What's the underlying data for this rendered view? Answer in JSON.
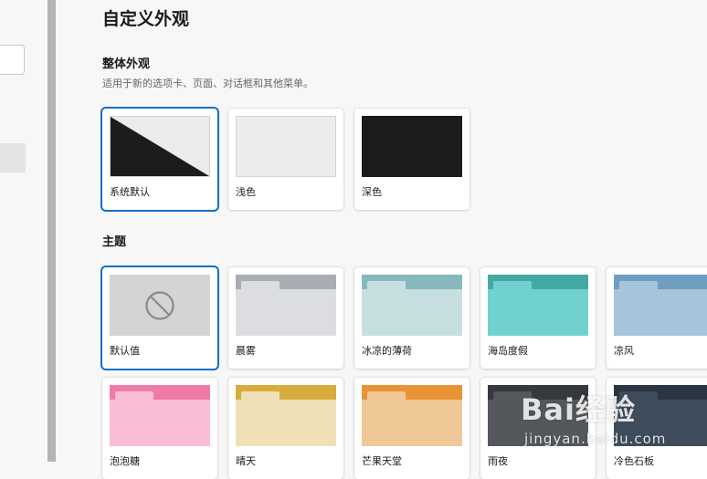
{
  "page": {
    "title": "自定义外观"
  },
  "appearance": {
    "title": "整体外观",
    "description": "适用于新的选项卡、页面、对话框和其他菜单。",
    "options": [
      {
        "label": "系统默认",
        "selected": true
      },
      {
        "label": "浅色",
        "selected": false
      },
      {
        "label": "深色",
        "selected": false
      }
    ]
  },
  "themes": {
    "title": "主题",
    "items": [
      {
        "label": "默认值",
        "selected": true,
        "icon": "none-icon"
      },
      {
        "label": "晨雾",
        "bar": "#a9adb3",
        "tab": "#dcdde1",
        "body": "#dcdde1"
      },
      {
        "label": "冰凉的薄荷",
        "bar": "#87b8bd",
        "tab": "#c8dfe2",
        "body": "#c8dfe2"
      },
      {
        "label": "海岛度假",
        "bar": "#44a9a3",
        "tab": "#71d1cf",
        "body": "#71d1cf"
      },
      {
        "label": "凉风",
        "bar": "#6e9fc3",
        "tab": "#a6c4dc",
        "body": "#a6c4dc"
      },
      {
        "label": "泡泡糖",
        "bar": "#f07aa8",
        "tab": "#f9bed6",
        "body": "#f9bed6"
      },
      {
        "label": "晴天",
        "bar": "#d7ac3c",
        "tab": "#efe0b8",
        "body": "#efe0b8"
      },
      {
        "label": "芒果天堂",
        "bar": "#e99335",
        "tab": "#f0c797",
        "body": "#f0c797"
      },
      {
        "label": "雨夜",
        "bar": "#35383d",
        "tab": "#54575c",
        "body": "#54575c"
      },
      {
        "label": "冷色石板",
        "bar": "#2b3541",
        "tab": "#3f4c5b",
        "body": "#3f4c5b"
      }
    ]
  },
  "colors": {
    "selected_border": "#0a6fc9"
  },
  "watermark": {
    "main": "Bai经验",
    "sub": "jingyan.baidu.com"
  }
}
